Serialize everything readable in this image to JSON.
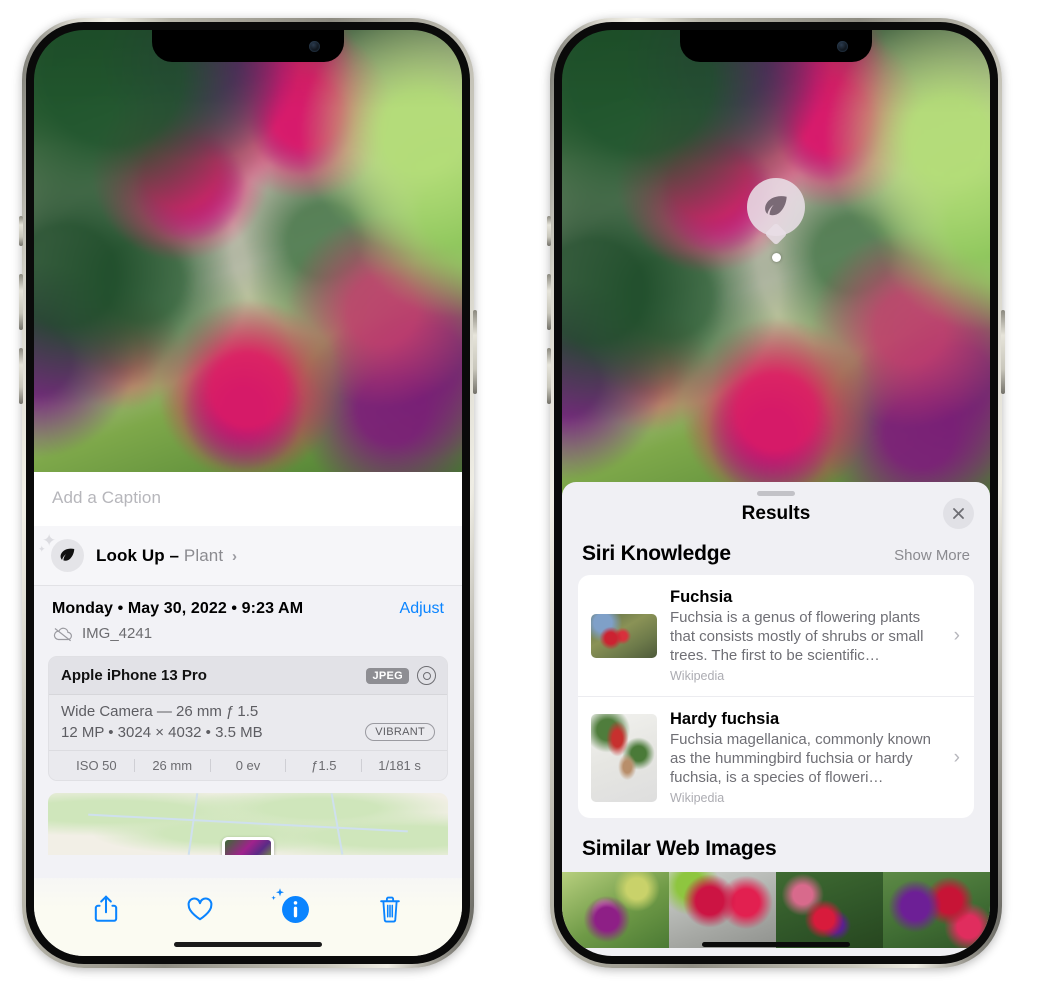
{
  "left_phone": {
    "caption_placeholder": "Add a Caption",
    "lookup": {
      "label": "Look Up –",
      "subject": "Plant",
      "chevron": "›",
      "icon": "leaf-icon"
    },
    "metadata": {
      "date_line": "Monday • May 30, 2022 • 9:23 AM",
      "adjust_label": "Adjust",
      "filename": "IMG_4241",
      "cloud_icon": "cloud-slash-icon"
    },
    "exif": {
      "device": "Apple iPhone 13 Pro",
      "format_badge": "JPEG",
      "raw_icon": "aperture-icon",
      "lens_line": "Wide Camera — 26 mm ƒ 1.5",
      "size_line": "12 MP • 3024 × 4032 • 3.5 MB",
      "style_badge": "VIBRANT",
      "stats": [
        "ISO 50",
        "26 mm",
        "0 ev",
        "ƒ1.5",
        "1/181 s"
      ]
    },
    "toolbar": [
      {
        "name": "share-button",
        "icon": "share-icon"
      },
      {
        "name": "favorite-button",
        "icon": "heart-icon"
      },
      {
        "name": "info-button",
        "icon": "info-sparkle-icon"
      },
      {
        "name": "delete-button",
        "icon": "trash-icon"
      }
    ]
  },
  "right_phone": {
    "visual_lookup_pin": {
      "icon": "leaf-icon"
    },
    "sheet": {
      "title": "Results",
      "close_icon": "close-icon"
    },
    "siri_knowledge": {
      "heading": "Siri Knowledge",
      "action": "Show More",
      "items": [
        {
          "title": "Fuchsia",
          "description": "Fuchsia is a genus of flowering plants that consists mostly of shrubs or small trees. The first to be scientific…",
          "source": "Wikipedia",
          "chevron": "›"
        },
        {
          "title": "Hardy fuchsia",
          "description": "Fuchsia magellanica, commonly known as the hummingbird fuchsia or hardy fuchsia, is a species of floweri…",
          "source": "Wikipedia",
          "chevron": "›"
        }
      ]
    },
    "similar_web_images": {
      "heading": "Similar Web Images",
      "thumbnails": [
        "fuchsia-web-image-1",
        "fuchsia-web-image-2",
        "fuchsia-web-image-3",
        "fuchsia-web-image-4"
      ]
    }
  },
  "colors": {
    "accent_blue": "#0a84ff",
    "sheet_bg": "#f0f0f4",
    "card_bg": "#ffffff",
    "secondary_text": "#6f6f75",
    "muted_text": "#acacb2"
  }
}
